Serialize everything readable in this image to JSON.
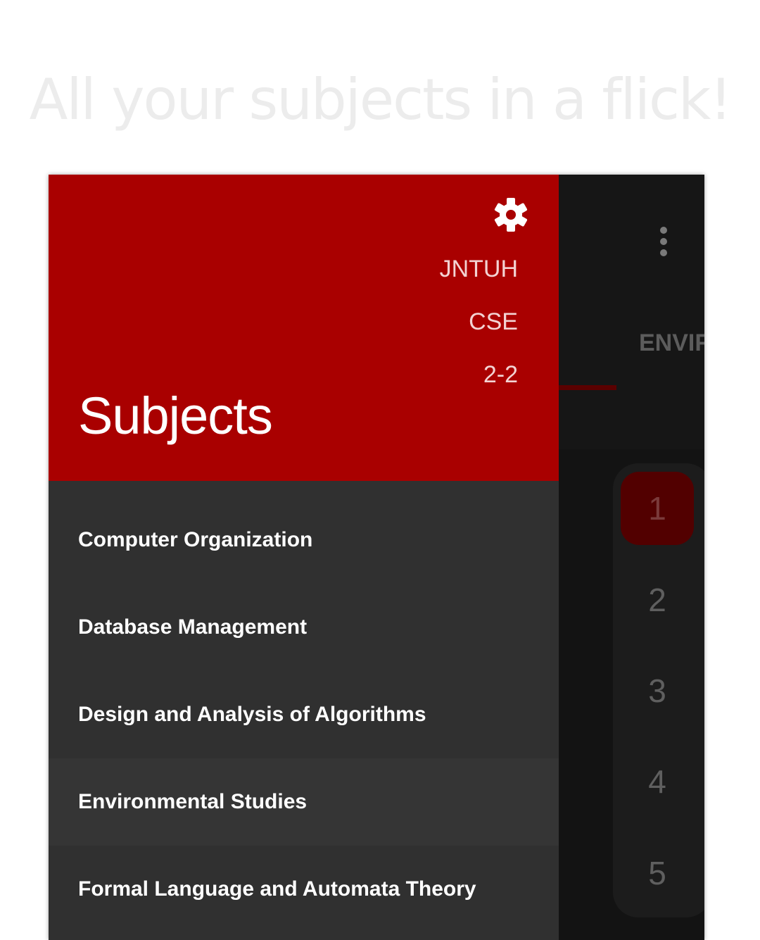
{
  "tagline": "All your subjects in a flick!",
  "background_app": {
    "tab_label": "ENVIF",
    "pages": [
      "1",
      "2",
      "3",
      "4",
      "5"
    ],
    "active_page": "1"
  },
  "drawer": {
    "header": {
      "university": "JNTUH",
      "branch": "CSE",
      "semester": "2-2",
      "title": "Subjects"
    },
    "items": [
      {
        "label": "Computer Organization"
      },
      {
        "label": "Database Management"
      },
      {
        "label": "Design and Analysis of Algorithms"
      },
      {
        "label": "Environmental Studies"
      },
      {
        "label": "Formal Language and Automata Theory"
      }
    ]
  },
  "icons": {
    "settings": "gear-icon",
    "overflow_menu": "more-vert-icon"
  },
  "colors": {
    "accent": "#a90000",
    "drawer_bg": "#303030",
    "app_bg": "#131313"
  }
}
